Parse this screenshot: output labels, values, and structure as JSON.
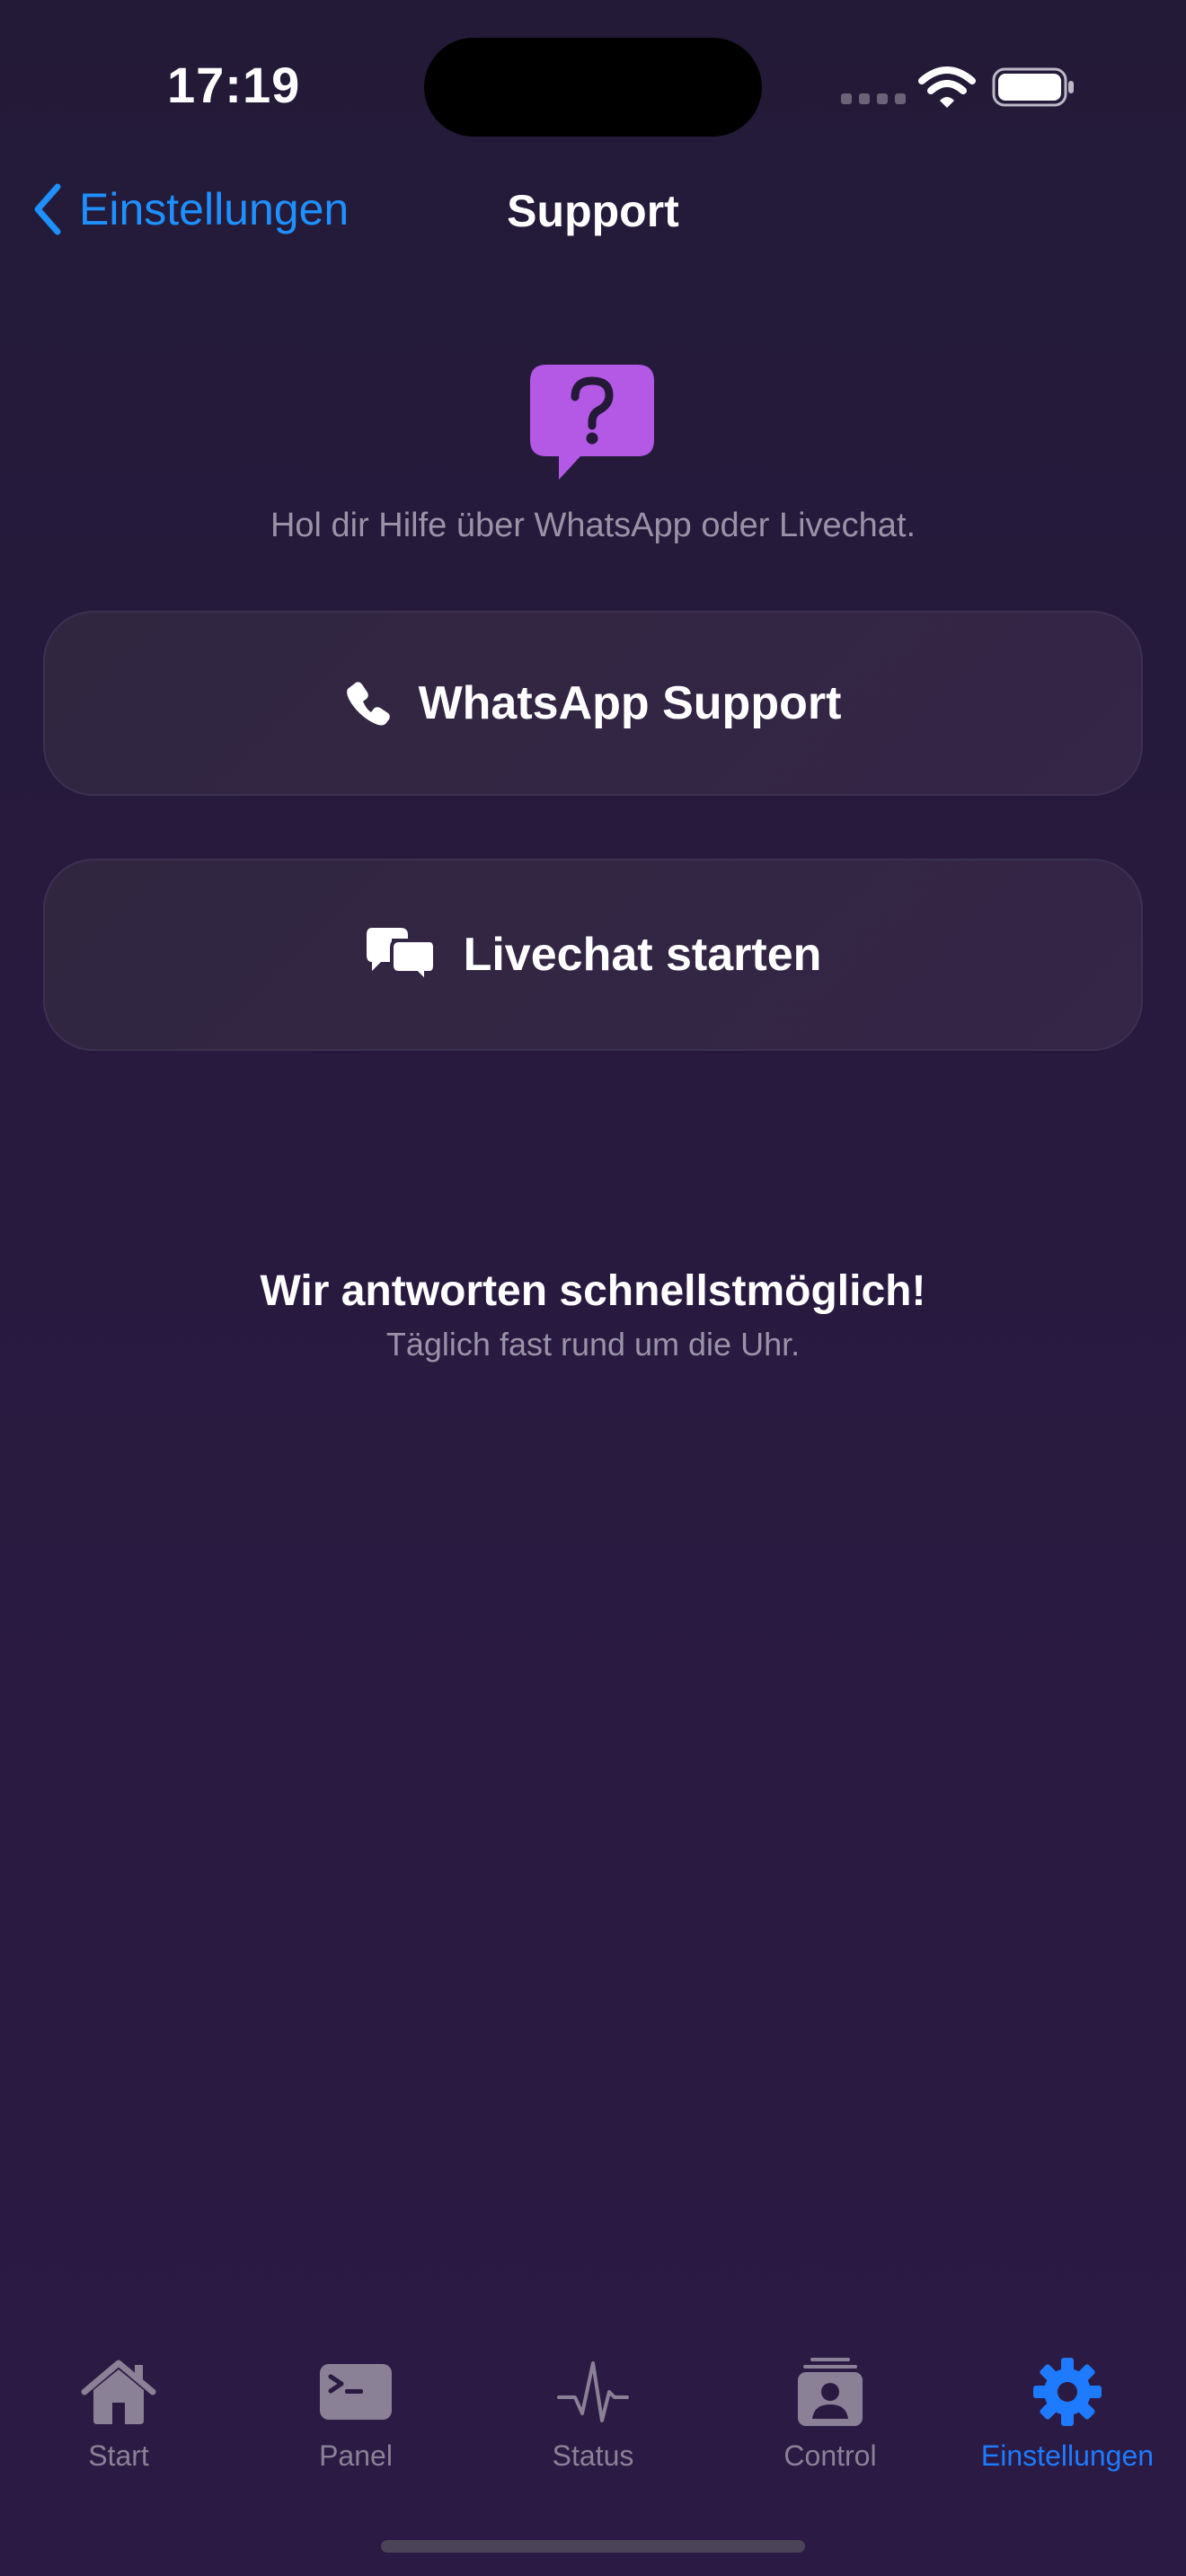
{
  "status_bar": {
    "time": "17:19"
  },
  "nav": {
    "back_label": "Einstellungen",
    "title": "Support"
  },
  "hero": {
    "icon": "help-bubble-icon",
    "subtitle": "Hol dir Hilfe über WhatsApp oder Livechat."
  },
  "actions": {
    "whatsapp": {
      "label": "WhatsApp Support",
      "icon": "phone-icon"
    },
    "livechat": {
      "label": "Livechat starten",
      "icon": "chat-bubbles-icon"
    }
  },
  "info": {
    "title": "Wir antworten schnellstmöglich!",
    "subtitle": "Täglich fast rund um die Uhr."
  },
  "tabs": [
    {
      "label": "Start",
      "icon": "house-icon",
      "active": false
    },
    {
      "label": "Panel",
      "icon": "terminal-icon",
      "active": false
    },
    {
      "label": "Status",
      "icon": "pulse-icon",
      "active": false
    },
    {
      "label": "Control",
      "icon": "contact-card-icon",
      "active": false
    },
    {
      "label": "Einstellungen",
      "icon": "gear-icon",
      "active": true
    }
  ],
  "colors": {
    "accent": "#1e7bff",
    "help_icon": "#b458e6",
    "inactive_tab": "#8a8197",
    "background_top": "#231a38",
    "background_bottom": "#2b1a43"
  }
}
